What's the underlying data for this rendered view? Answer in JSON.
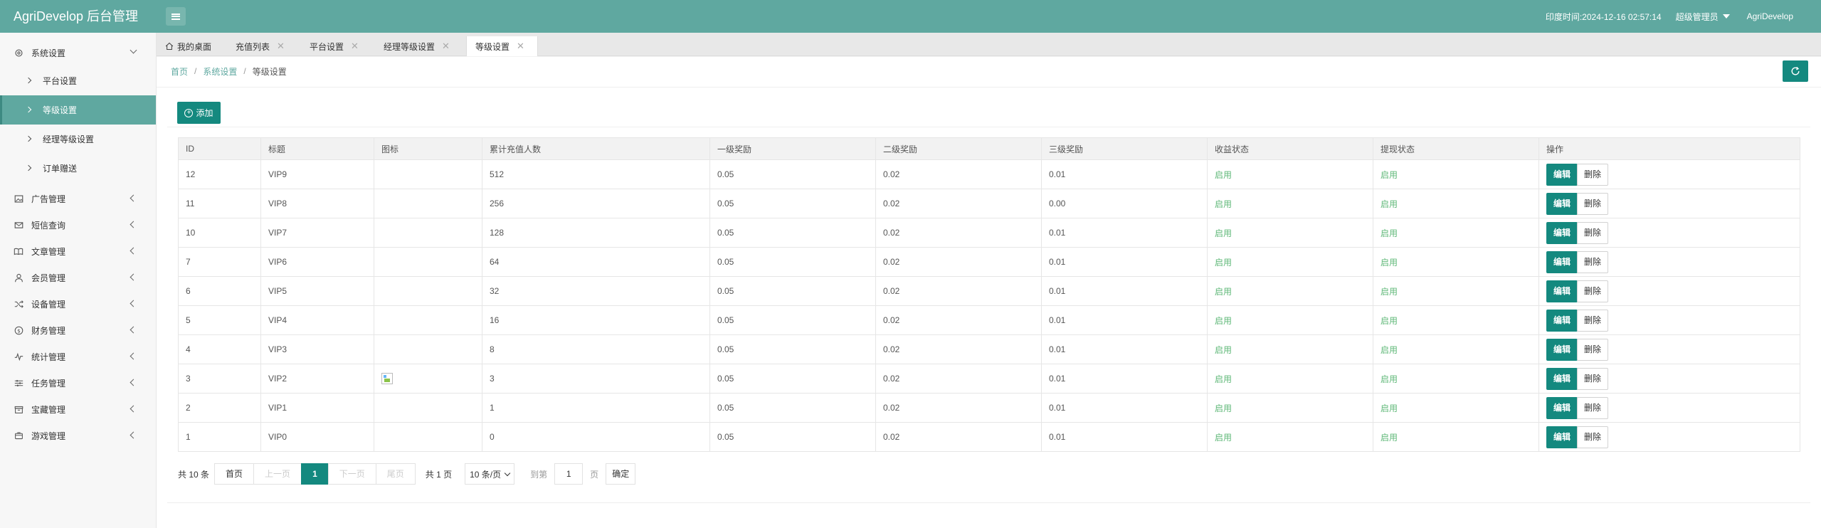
{
  "header": {
    "title": "AgriDevelop 后台管理",
    "time_label": "印度时间:",
    "time_value": "2024-12-16 02:57:14",
    "role": "超级管理员",
    "username": "AgriDevelop"
  },
  "sidebar": {
    "system": {
      "label": "系统设置",
      "icon": "gear-icon"
    },
    "sub_items": [
      {
        "label": "平台设置"
      },
      {
        "label": "等级设置"
      },
      {
        "label": "经理等级设置"
      },
      {
        "label": "订单赠送"
      }
    ],
    "groups": [
      {
        "label": "广告管理",
        "icon": "image-icon"
      },
      {
        "label": "短信查询",
        "icon": "mail-icon"
      },
      {
        "label": "文章管理",
        "icon": "book-icon"
      },
      {
        "label": "会员管理",
        "icon": "user-icon"
      },
      {
        "label": "设备管理",
        "icon": "shuffle-icon"
      },
      {
        "label": "财务管理",
        "icon": "dollar-icon"
      },
      {
        "label": "统计管理",
        "icon": "pulse-icon"
      },
      {
        "label": "任务管理",
        "icon": "sliders-icon"
      },
      {
        "label": "宝藏管理",
        "icon": "box-icon"
      },
      {
        "label": "游戏管理",
        "icon": "gamepad-icon"
      }
    ]
  },
  "tabs": [
    {
      "label": "我的桌面",
      "icon": "home-icon"
    },
    {
      "label": "充值列表"
    },
    {
      "label": "平台设置"
    },
    {
      "label": "经理等级设置"
    },
    {
      "label": "等级设置"
    }
  ],
  "breadcrumb": {
    "home": "首页",
    "section": "系统设置",
    "current": "等级设置"
  },
  "toolbar": {
    "add_label": "添加"
  },
  "table": {
    "columns": [
      "ID",
      "标题",
      "图标",
      "累计充值人数",
      "一级奖励",
      "二级奖励",
      "三级奖励",
      "收益状态",
      "提现状态",
      "操作"
    ],
    "edit_label": "编辑",
    "delete_label": "删除",
    "rows": [
      {
        "id": "12",
        "title": "VIP9",
        "count": "512",
        "r1": "0.05",
        "r2": "0.02",
        "r3": "0.01",
        "income": "启用",
        "withdraw": "启用"
      },
      {
        "id": "11",
        "title": "VIP8",
        "count": "256",
        "r1": "0.05",
        "r2": "0.02",
        "r3": "0.00",
        "income": "启用",
        "withdraw": "启用"
      },
      {
        "id": "10",
        "title": "VIP7",
        "count": "128",
        "r1": "0.05",
        "r2": "0.02",
        "r3": "0.01",
        "income": "启用",
        "withdraw": "启用"
      },
      {
        "id": "7",
        "title": "VIP6",
        "count": "64",
        "r1": "0.05",
        "r2": "0.02",
        "r3": "0.01",
        "income": "启用",
        "withdraw": "启用"
      },
      {
        "id": "6",
        "title": "VIP5",
        "count": "32",
        "r1": "0.05",
        "r2": "0.02",
        "r3": "0.01",
        "income": "启用",
        "withdraw": "启用"
      },
      {
        "id": "5",
        "title": "VIP4",
        "count": "16",
        "r1": "0.05",
        "r2": "0.02",
        "r3": "0.01",
        "income": "启用",
        "withdraw": "启用"
      },
      {
        "id": "4",
        "title": "VIP3",
        "count": "8",
        "r1": "0.05",
        "r2": "0.02",
        "r3": "0.01",
        "income": "启用",
        "withdraw": "启用"
      },
      {
        "id": "3",
        "title": "VIP2",
        "count": "3",
        "r1": "0.05",
        "r2": "0.02",
        "r3": "0.01",
        "income": "启用",
        "withdraw": "启用",
        "has_icon": true
      },
      {
        "id": "2",
        "title": "VIP1",
        "count": "1",
        "r1": "0.05",
        "r2": "0.02",
        "r3": "0.01",
        "income": "启用",
        "withdraw": "启用"
      },
      {
        "id": "1",
        "title": "VIP0",
        "count": "0",
        "r1": "0.05",
        "r2": "0.02",
        "r3": "0.01",
        "income": "启用",
        "withdraw": "启用"
      }
    ]
  },
  "pagination": {
    "count": "共 10 条",
    "first": "首页",
    "prev": "上一页",
    "current": "1",
    "next": "下一页",
    "last": "尾页",
    "total_pages": "共 1 页",
    "page_size": "10 条/页",
    "goto_label": "到第",
    "goto_value": "1",
    "page_unit": "页",
    "confirm": "确定"
  },
  "colors": {
    "header": "#5fa8a0",
    "accent": "#14897f",
    "enabled": "#5fb878"
  }
}
